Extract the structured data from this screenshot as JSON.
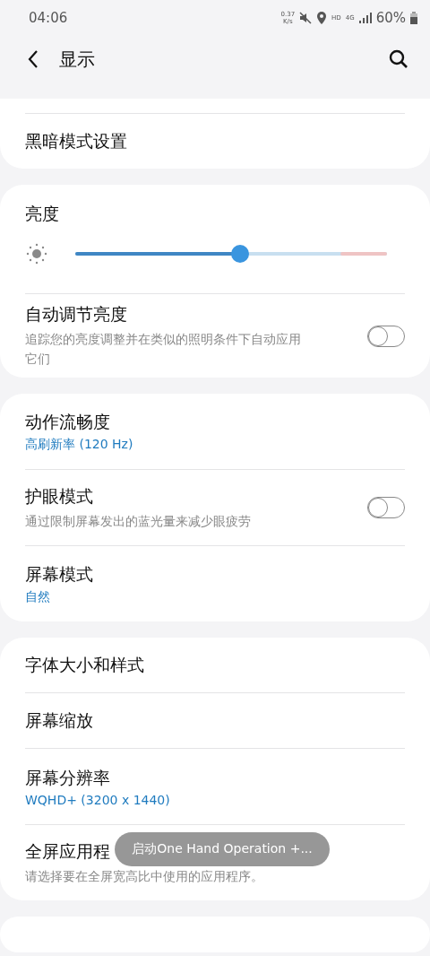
{
  "status_bar": {
    "time": "04:06",
    "speed_value": "0.37",
    "speed_unit": "K/s",
    "hd": "HD",
    "network": "4G",
    "battery": "60%"
  },
  "header": {
    "title": "显示"
  },
  "groups": [
    {
      "clipped_top": true,
      "items": [
        {
          "kind": "link",
          "title": "黑暗模式设置"
        }
      ]
    },
    {
      "items": [
        {
          "kind": "slider",
          "title": "亮度",
          "level": 0.53
        },
        {
          "kind": "toggle",
          "title": "自动调节亮度",
          "description": "追踪您的亮度调整并在类似的照明条件下自动应用它们",
          "on": false
        }
      ]
    },
    {
      "items": [
        {
          "kind": "value",
          "title": "动作流畅度",
          "value": "高刷新率 (120 Hz)"
        },
        {
          "kind": "toggle",
          "title": "护眼模式",
          "description": "通过限制屏幕发出的蓝光量来减少眼疲劳",
          "on": false
        },
        {
          "kind": "value",
          "title": "屏幕模式",
          "value": "自然"
        }
      ]
    },
    {
      "items": [
        {
          "kind": "link",
          "title": "字体大小和样式"
        },
        {
          "kind": "link",
          "title": "屏幕缩放"
        },
        {
          "kind": "value",
          "title": "屏幕分辨率",
          "value": "WQHD+ (3200 x 1440)"
        },
        {
          "kind": "toggle_less",
          "title": "全屏应用程",
          "description": "请选择要在全屏宽高比中使用的应用程序。"
        }
      ]
    }
  ],
  "toast": {
    "text": "启动One Hand Operation +..."
  }
}
